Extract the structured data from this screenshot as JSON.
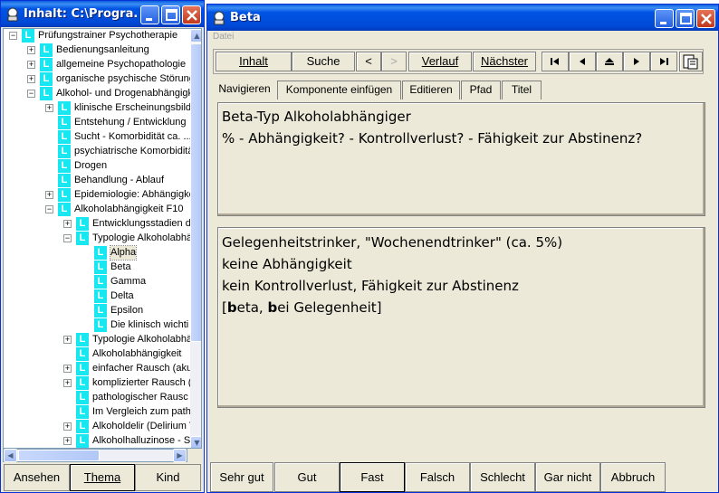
{
  "left_window": {
    "title": "Inhalt: C:\\Progra...",
    "tree": [
      {
        "label": "Prüfungstrainer Psychotherapie",
        "level": 0,
        "exp": "-"
      },
      {
        "label": "Bedienungsanleitung",
        "level": 1,
        "exp": "+"
      },
      {
        "label": "allgemeine Psychopathologie",
        "level": 1,
        "exp": "+"
      },
      {
        "label": "organische psychische Störung",
        "level": 1,
        "exp": "+"
      },
      {
        "label": "Alkohol- und Drogenabhängigk",
        "level": 1,
        "exp": "-"
      },
      {
        "label": "klinische Erscheinungsbild",
        "level": 2,
        "exp": "+"
      },
      {
        "label": "Entstehung / Entwicklung",
        "level": 2,
        "exp": ""
      },
      {
        "label": "Sucht - Komorbidität  ca. ...",
        "level": 2,
        "exp": ""
      },
      {
        "label": "psychiatrische Komorbiditä",
        "level": 2,
        "exp": ""
      },
      {
        "label": "Drogen",
        "level": 2,
        "exp": ""
      },
      {
        "label": "Behandlung - Ablauf",
        "level": 2,
        "exp": ""
      },
      {
        "label": "Epidemiologie: Abhängigke",
        "level": 2,
        "exp": "+"
      },
      {
        "label": "Alkoholabhängigkeit F10",
        "level": 2,
        "exp": "-"
      },
      {
        "label": "Entwicklungsstadien d",
        "level": 3,
        "exp": "+"
      },
      {
        "label": "Typologie Alkoholabhä",
        "level": 3,
        "exp": "-"
      },
      {
        "label": "Alpha",
        "level": 4,
        "exp": "",
        "selected": true
      },
      {
        "label": "Beta",
        "level": 4,
        "exp": ""
      },
      {
        "label": "Gamma",
        "level": 4,
        "exp": ""
      },
      {
        "label": "Delta",
        "level": 4,
        "exp": ""
      },
      {
        "label": "Epsilon",
        "level": 4,
        "exp": ""
      },
      {
        "label": "Die klinisch wichti",
        "level": 4,
        "exp": ""
      },
      {
        "label": "Typologie Alkoholabhä",
        "level": 3,
        "exp": "+"
      },
      {
        "label": "Alkoholabhängigkeit",
        "level": 3,
        "exp": ""
      },
      {
        "label": "einfacher Rausch (aku",
        "level": 3,
        "exp": "+"
      },
      {
        "label": "komplizierter Rausch (",
        "level": 3,
        "exp": "+"
      },
      {
        "label": "pathologischer Rausc",
        "level": 3,
        "exp": ""
      },
      {
        "label": "Im Vergleich zum path",
        "level": 3,
        "exp": ""
      },
      {
        "label": "Alkoholdelir (Delirium T",
        "level": 3,
        "exp": "+"
      },
      {
        "label": "Alkoholhalluzinose - S",
        "level": 3,
        "exp": "+"
      }
    ],
    "tree_icon_letter": "L",
    "buttons": {
      "ansehen": "Ansehen",
      "thema": "Thema",
      "kind": "Kind"
    }
  },
  "right_window": {
    "title": "Beta",
    "menu": "Datei",
    "toolbar": {
      "inhalt": "Inhalt",
      "suche": "Suche",
      "prev": "<",
      "next": ">",
      "verlauf": "Verlauf",
      "naechster": "Nächster"
    },
    "tabs": [
      "Navigieren",
      "Komponente einfügen",
      "Editieren",
      "Pfad",
      "Titel"
    ],
    "question": {
      "line1": "Beta-Typ Alkoholabhängiger",
      "line2": "% - Abhängigkeit? - Kontrollverlust? - Fähigkeit zur Abstinenz?"
    },
    "answer": {
      "line1": "Gelegenheitstrinker, \"Wochenendtrinker\" (ca. 5%)",
      "line2": "keine Abhängigkeit",
      "line3": "kein Kontrollverlust, Fähigkeit zur Abstinenz",
      "line4a_bold": "b",
      "line4b": "eta, ",
      "line4c_bold": "b",
      "line4d": "ei Gelegenheit]",
      "line4_open": "["
    },
    "rating_buttons": [
      "Sehr gut",
      "Gut",
      "Fast",
      "Falsch",
      "Schlecht",
      "Gar nicht",
      "Abbruch"
    ]
  },
  "colors": {
    "tree_icon": "#18e6f0",
    "title_blue": "#0054e3",
    "window_bg": "#ece9d8"
  }
}
